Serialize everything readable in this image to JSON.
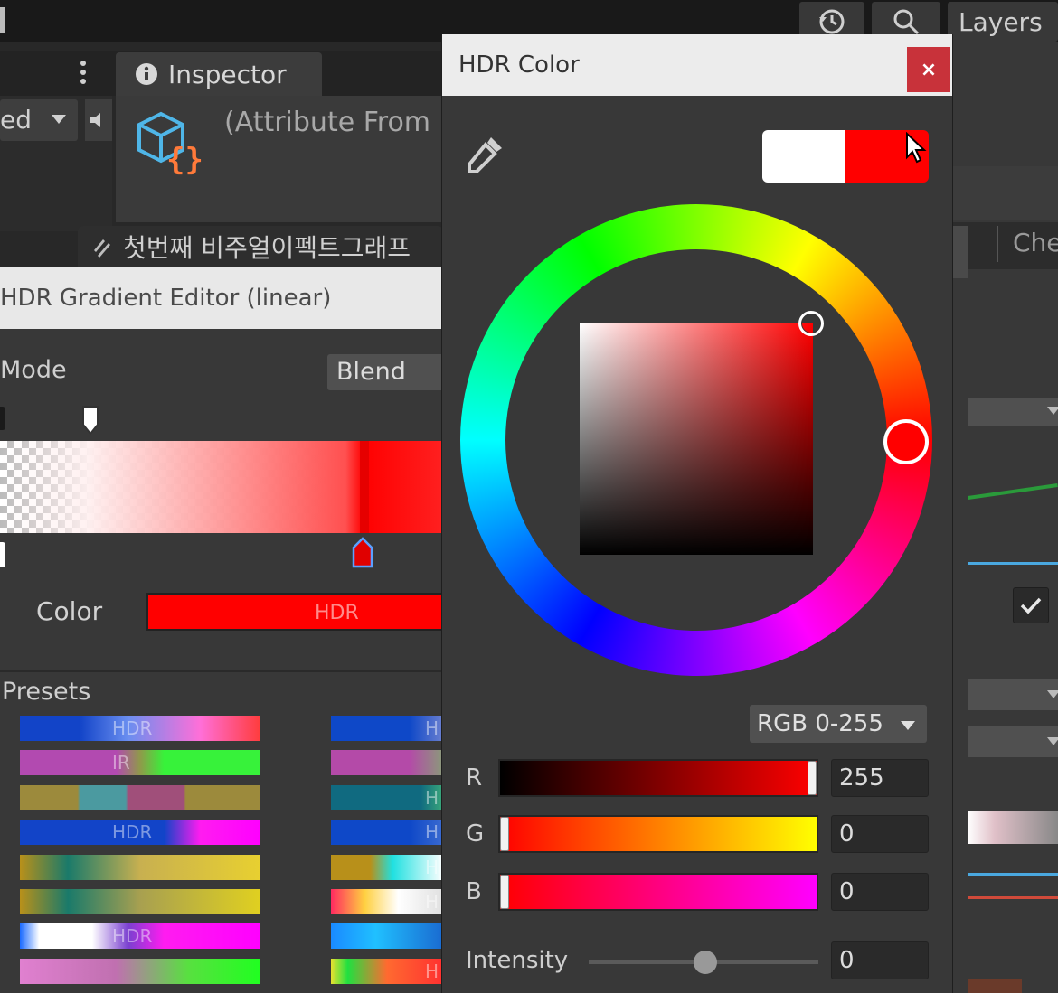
{
  "toolbar": {
    "layers_label": "Layers",
    "history_icon": "history-icon",
    "search_icon": "search-icon"
  },
  "inspector": {
    "tab_label": "Inspector",
    "attribute_text": "(Attribute From",
    "left_dropdown_text": "ed"
  },
  "vfx_tab": {
    "label": "첫번째 비주얼이펙트그래프"
  },
  "gradient_editor": {
    "title": "HDR Gradient Editor (linear)",
    "mode_label": "Mode",
    "mode_value": "Blend",
    "color_label": "Color",
    "color_badge": "HDR",
    "presets_label": "Presets",
    "presets_left": [
      {
        "text": "HDR",
        "gradient": "linear-gradient(to right,#1244c8 0%,#1244c8 25%,#6a8ef0 45%,#ff6fd8 75%,#ff3c3c 100%)"
      },
      {
        "text": "IR",
        "gradient": "linear-gradient(to right,#b24ab0 0%,#b24ab0 40%,#8f9a4a 50%,#37f23a 60%,#37f23a 100%)"
      },
      {
        "text": "",
        "gradient": "linear-gradient(to right,#9c8a3c 0%,#9c8a3c 24%,#4b9aa0 25%,#4b9aa0 44%,#a04f7a 45%,#a04f7a 68%,#9c8a3c 69%,#9c8a3c 100%)"
      },
      {
        "text": "HDR",
        "gradient": "linear-gradient(to right,#1244c8 0%,#1244c8 60%,#ff1cf0 75%,#ff00ff 100%)"
      },
      {
        "text": "",
        "gradient": "linear-gradient(to right,#b8901a 0%,#1a7a6a 20%,#c8b050 50%,#e8d030 100%)"
      },
      {
        "text": "",
        "gradient": "linear-gradient(to right,#b8901a 0%,#1a7a6a 20%,#a8a050 50%,#e0d020 100%)"
      },
      {
        "text": "HDR",
        "gradient": "linear-gradient(to right,#1a6aff 0%,#ffffff 8%,#ffffff 30%,#7a40d0 45%,#ff1cf0 60%,#ff00ff 100%)"
      },
      {
        "text": "",
        "gradient": "linear-gradient(to right,#e080d0 0%,#c070b0 40%,#58e040 70%,#20ff20 100%)"
      }
    ],
    "presets_right": [
      {
        "text": "H",
        "gradient": "linear-gradient(to right,#0e48c8 0%,#0e48c8 70%,#6a7fd0 100%)"
      },
      {
        "text": "",
        "gradient": "linear-gradient(to right,#b44aa8 0%,#b44aa8 70%,#8a9a7a 100%)"
      },
      {
        "text": "H",
        "gradient": "linear-gradient(to right,#106a80 0%,#106a80 80%,#3aa87a 100%)"
      },
      {
        "text": "H",
        "gradient": "linear-gradient(to right,#0e48c8 0%,#0e48c8 70%,#3a6ad0 100%)"
      },
      {
        "text": "H",
        "gradient": "linear-gradient(to right,#b8901a 0%,#b8901a 35%,#20e0e0 55%,#ffffff 100%)"
      },
      {
        "text": "H",
        "gradient": "linear-gradient(to right,#ff2a60 0%,#ffd040 30%,#ffffff 60%,#e0e0e0 100%)"
      },
      {
        "text": "",
        "gradient": "linear-gradient(to right,#1a8aff 0%,#20c0ff 40%,#1a6ad0 100%)"
      },
      {
        "text": "H",
        "gradient": "linear-gradient(to right,#e8e030 0%,#20e040 15%,#ff6a30 50%,#ff3030 100%)"
      }
    ]
  },
  "color_picker": {
    "title": "HDR Color",
    "close_label": "×",
    "eyedropper_icon": "eyedropper-icon",
    "mode_select": "RGB 0-255",
    "channels": [
      {
        "label": "R",
        "value": "255",
        "fraction": 1.0,
        "gradient": "linear-gradient(to right,#000000,#ff0000)"
      },
      {
        "label": "G",
        "value": "0",
        "fraction": 0.0,
        "gradient": "linear-gradient(to right,#ff0000,#ffff00)"
      },
      {
        "label": "B",
        "value": "0",
        "fraction": 0.0,
        "gradient": "linear-gradient(to right,#ff0000,#ff00ff)"
      }
    ],
    "intensity_label": "Intensity",
    "intensity_value": "0",
    "current_color": "#ff0000",
    "previous_color": "#ffffff"
  },
  "right_panel": {
    "tab_label": "Che"
  }
}
